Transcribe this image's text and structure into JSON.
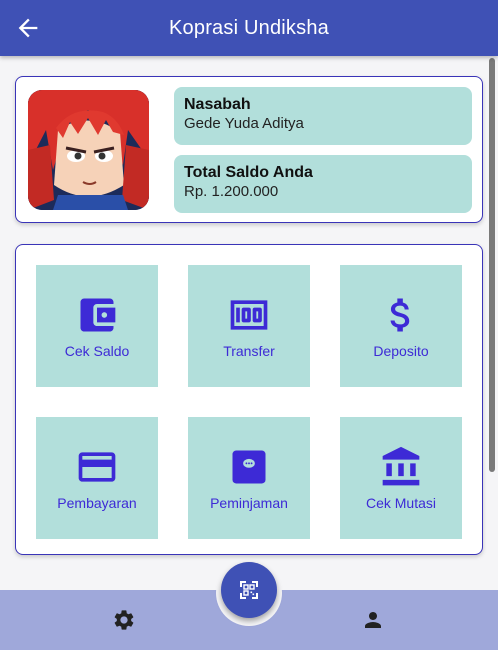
{
  "appbar": {
    "title": "Koprasi Undiksha",
    "back_icon": "arrow-left-icon"
  },
  "profile": {
    "avatar_alt": "avatar",
    "customer_label": "Nasabah",
    "customer_name": "Gede Yuda Aditya",
    "balance_label": "Total Saldo Anda",
    "balance_value": "Rp. 1.200.000"
  },
  "menu": {
    "items": [
      {
        "label": "Cek Saldo",
        "icon": "wallet-icon"
      },
      {
        "label": "Transfer",
        "icon": "money-icon"
      },
      {
        "label": "Deposito",
        "icon": "dollar-icon"
      },
      {
        "label": "Pembayaran",
        "icon": "credit-card-icon"
      },
      {
        "label": "Peminjaman",
        "icon": "loan-icon"
      },
      {
        "label": "Cek Mutasi",
        "icon": "bank-icon"
      }
    ]
  },
  "bottom_nav": {
    "left_icon": "gear-icon",
    "center_icon": "qr-scan-icon",
    "right_icon": "person-icon"
  },
  "colors": {
    "primary": "#3f51b5",
    "tile": "#b2dfdb",
    "icon": "#3d2ad6",
    "bottom_bar": "#9fa8da"
  }
}
